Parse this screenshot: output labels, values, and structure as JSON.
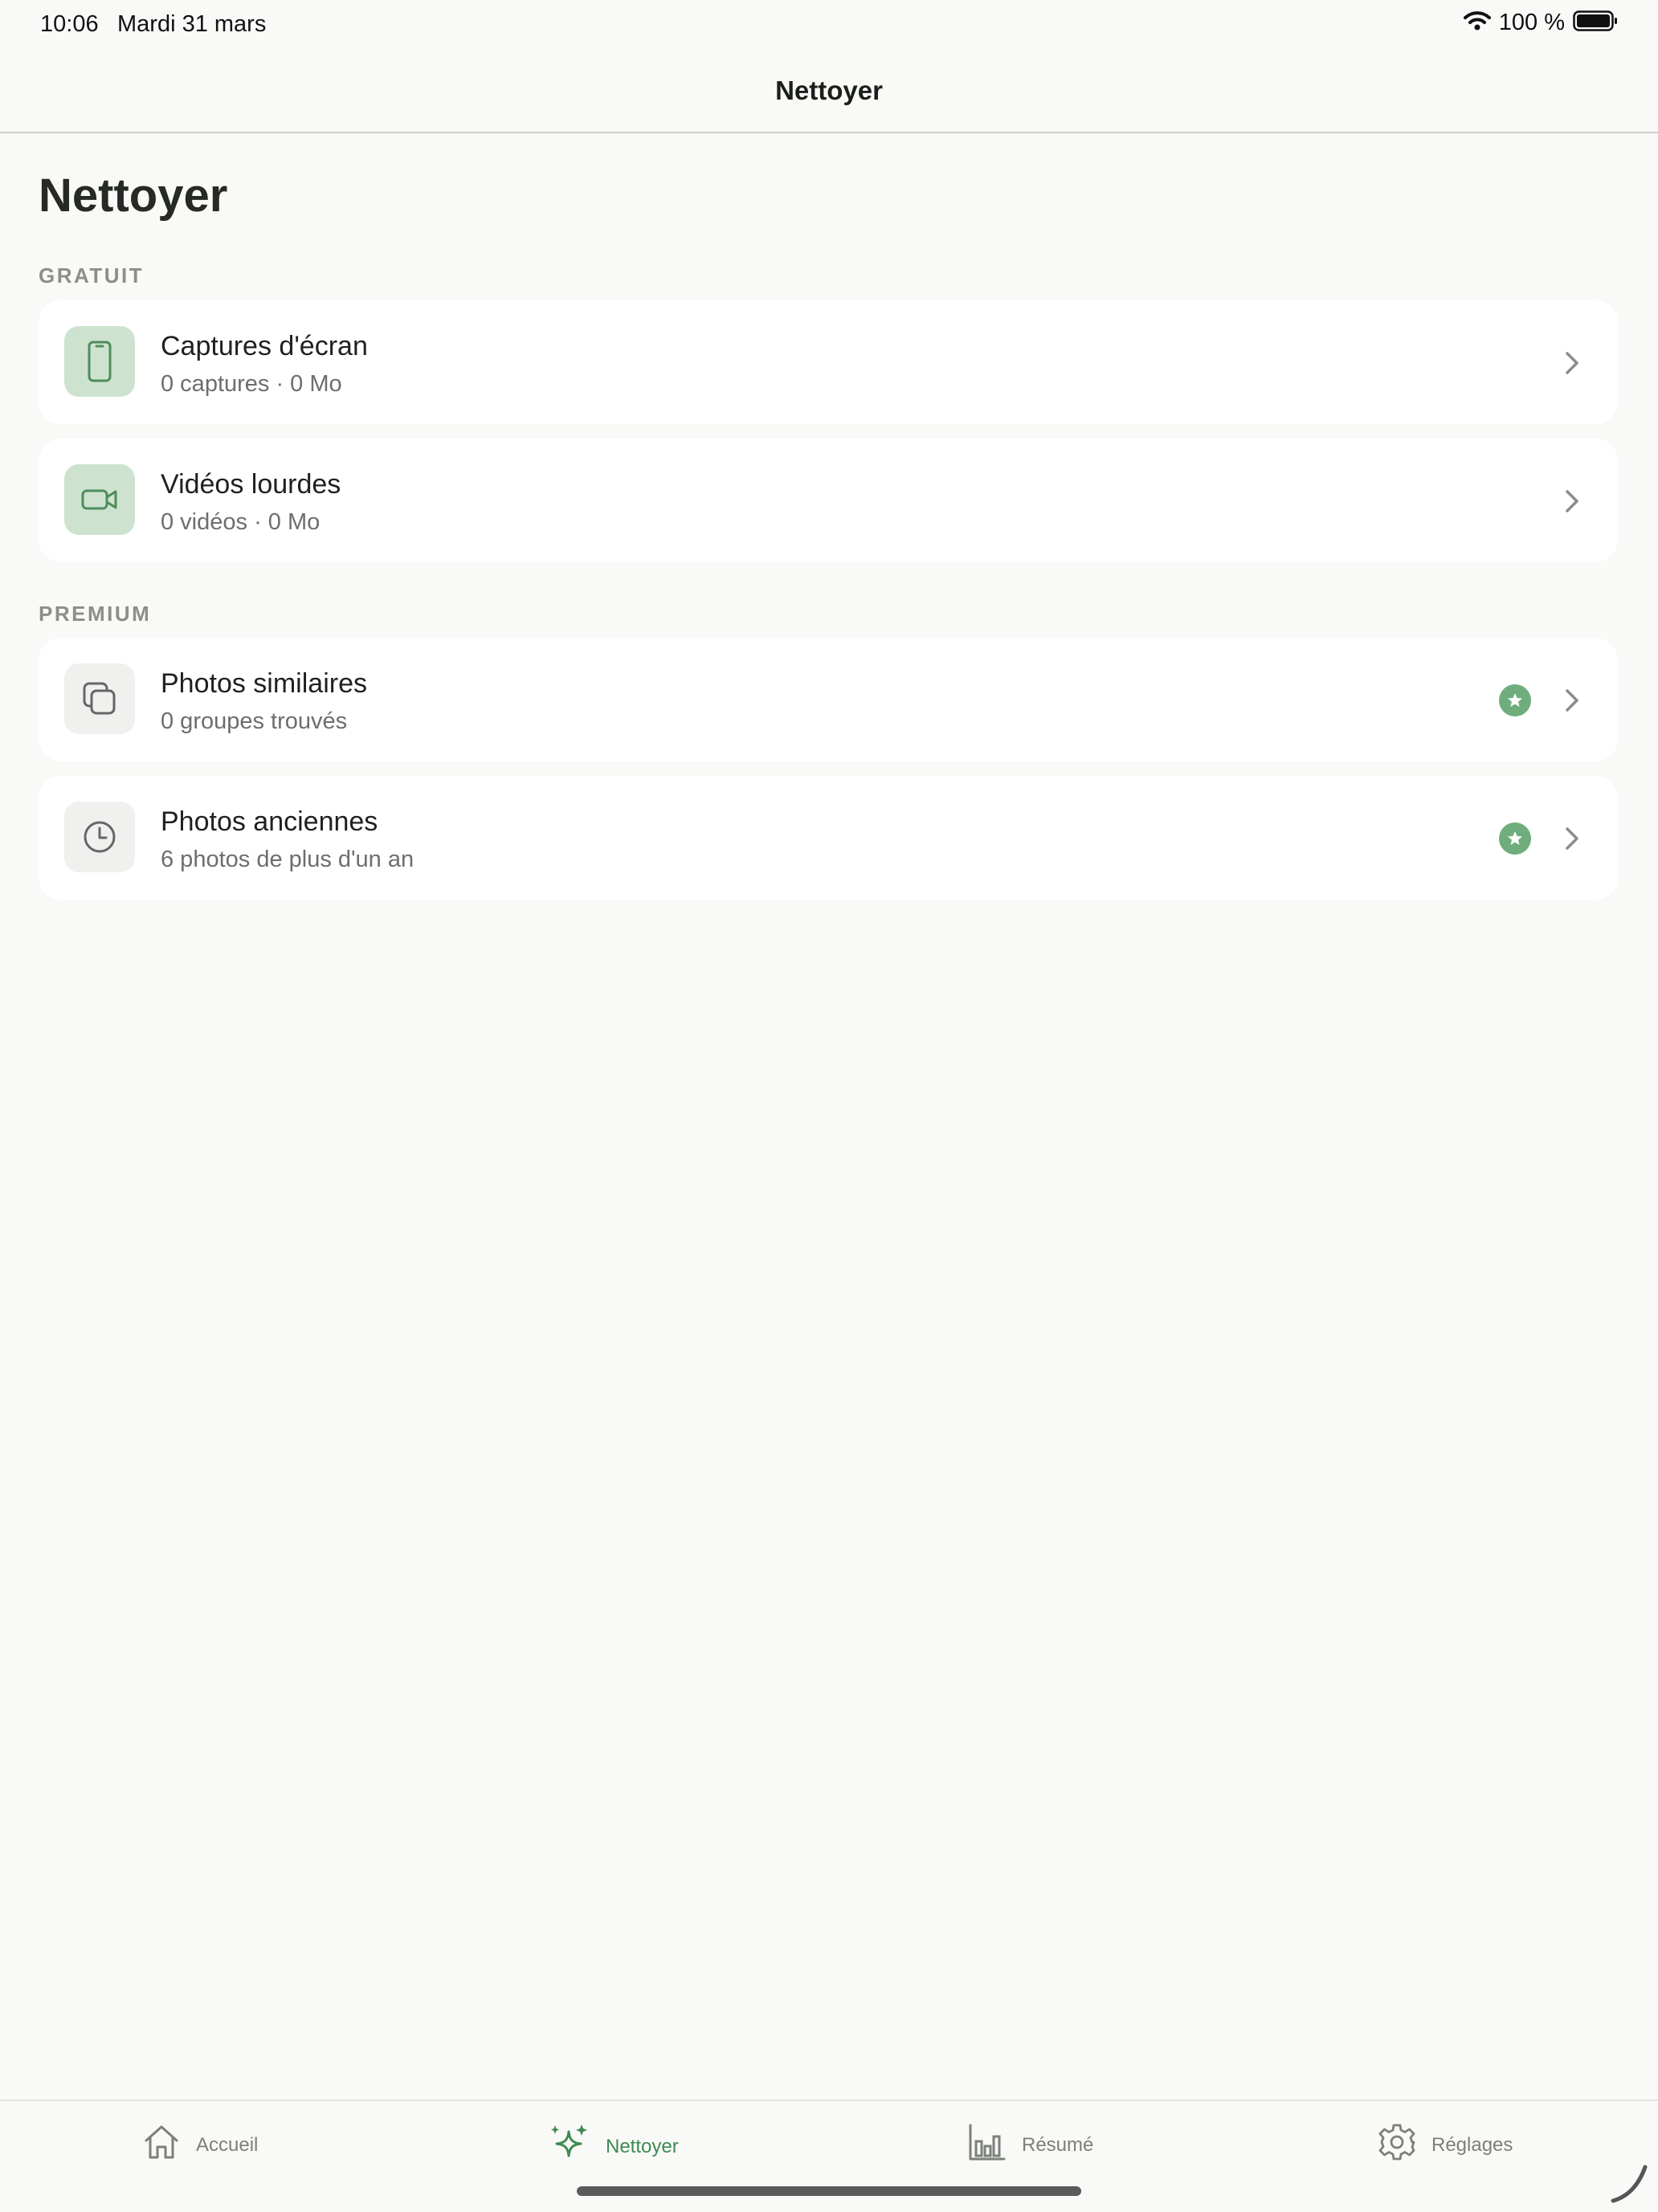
{
  "status_bar": {
    "time": "10:06",
    "date": "Mardi 31 mars",
    "battery": "100 %",
    "icons": [
      "wifi-icon",
      "battery-icon"
    ]
  },
  "nav": {
    "title": "Nettoyer"
  },
  "page": {
    "title": "Nettoyer"
  },
  "sections": {
    "free": {
      "label": "GRATUIT",
      "items": [
        {
          "title": "Captures d'écran",
          "subtitle": "0 captures · 0 Mo",
          "icon": "phone-icon"
        },
        {
          "title": "Vidéos lourdes",
          "subtitle": "0 vidéos · 0 Mo",
          "icon": "video-camera-icon"
        }
      ]
    },
    "premium": {
      "label": "PREMIUM",
      "items": [
        {
          "title": "Photos similaires",
          "subtitle": "0 groupes trouvés",
          "icon": "stacked-photos-icon",
          "badge": "star-icon"
        },
        {
          "title": "Photos anciennes",
          "subtitle": "6 photos de plus d'un an",
          "icon": "clock-icon",
          "badge": "star-icon"
        }
      ]
    }
  },
  "tab_bar": {
    "tabs": [
      {
        "label": "Accueil",
        "icon": "home-icon"
      },
      {
        "label": "Nettoyer",
        "icon": "sparkles-icon",
        "active": true
      },
      {
        "label": "Résumé",
        "icon": "bar-chart-icon"
      },
      {
        "label": "Réglages",
        "icon": "gear-icon"
      }
    ]
  },
  "colors": {
    "accent": "#3f8a52",
    "icon_green_bg": "#cde3d0",
    "badge_green": "#6fae7c",
    "background": "#f9f9f7"
  }
}
